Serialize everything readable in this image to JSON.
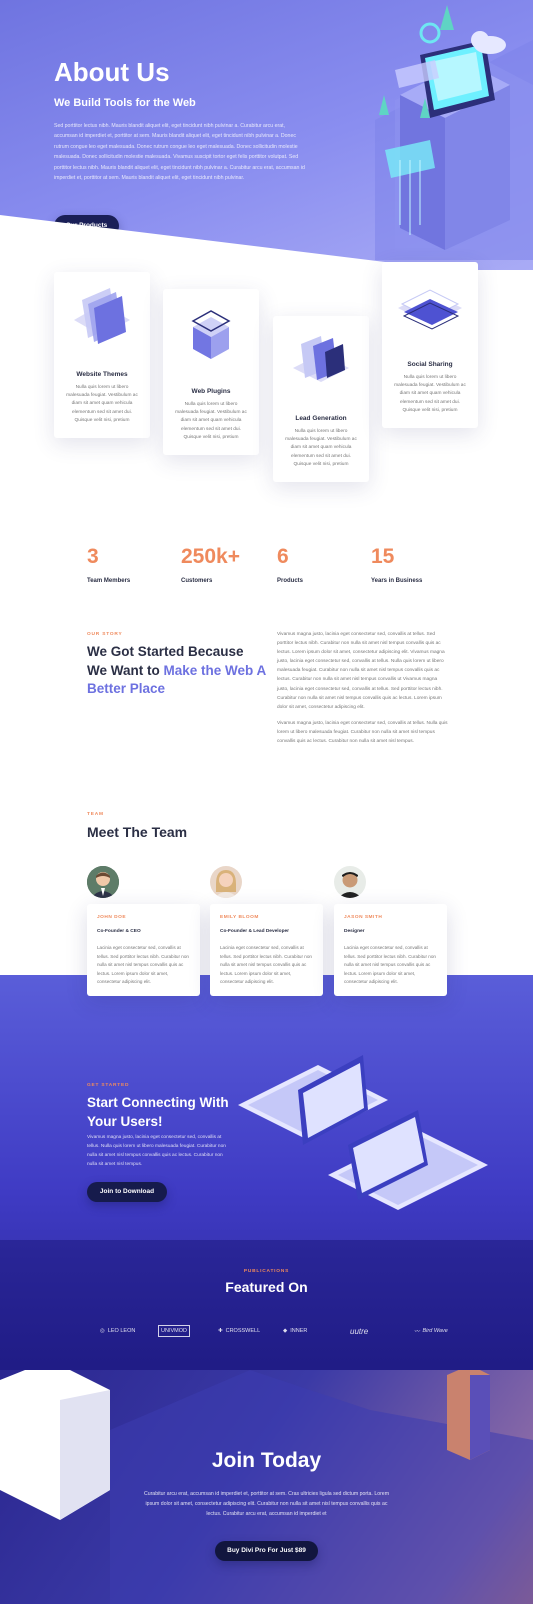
{
  "hero": {
    "title": "About Us",
    "subtitle": "We Build Tools for the Web",
    "text": "Sed porttitor lectus nibh. Mauris blandit aliquet elit, eget tincidunt nibh pulvinar a. Curabitur arcu erat, accumsan id imperdiet et, porttitor at sem. Mauris blandit aliquet elit, eget tincidunt nibh pulvinar a. Donec rutrum congue leo eget malesuada. Donec rutrum congue leo eget malesuada. Donec sollicitudin molestie malesuada. Donec sollicitudin molestie malesuada. Vivamus suscipit tortor eget felis porttitor volutpat. Sed porttitor lectus nibh. Mauris blandit aliquet elit, eget tincidunt nibh pulvinar a. Curabitur arcu erat, accumsan id imperdiet et, porttitor at sem. Mauris blandit aliquet elit, eget tincidunt nibh pulvinar.",
    "button": "Our Products"
  },
  "features": [
    {
      "title": "Website Themes",
      "text": "Nulla quis lorem ut libero malesuada feugiat. Vestibulum ac diam sit amet quam vehicula elementum sed sit amet dui. Quisque velit nisi, pretium",
      "icon": "layers-icon"
    },
    {
      "title": "Web Plugins",
      "text": "Nulla quis lorem ut libero malesuada feugiat. Vestibulum ac diam sit amet quam vehicula elementum sed sit amet dui. Quisque velit nisi, pretium",
      "icon": "cube-icon"
    },
    {
      "title": "Lead Generation",
      "text": "Nulla quis lorem ut libero malesuada feugiat. Vestibulum ac diam sit amet quam vehicula elementum sed sit amet dui. Quisque velit nisi, pretium",
      "icon": "funnel-icon"
    },
    {
      "title": "Social Sharing",
      "text": "Nulla quis lorem ut libero malesuada feugiat. Vestibulum ac diam sit amet quam vehicula elementum sed sit amet dui. Quisque velit nisi, pretium",
      "icon": "tablet-icon"
    }
  ],
  "stats": [
    {
      "value": "3",
      "label": "Team Members"
    },
    {
      "value": "250k+",
      "label": "Customers"
    },
    {
      "value": "6",
      "label": "Products"
    },
    {
      "value": "15",
      "label": "Years in Business"
    }
  ],
  "story": {
    "eyebrow": "OUR STORY",
    "heading_plain": "We Got Started Because We Want to ",
    "heading_accent": "Make the Web A Better Place",
    "para1": "Vivamus magna justo, lacinia eget consectetur sed, convallis at tellus. Sed porttitor lectus nibh. Curabitur non nulla sit amet nisl tempus convallis quis ac lectus. Lorem ipsum dolor sit amet, consectetur adipiscing elit. Vivamus magna justo, lacinia eget consectetur sed, convallis at tellus. Nulla quis lorem ut libero malesuada feugiat. Curabitur non nulla sit amet nisl tempus convallis quis ac lectus. Curabitur non nulla sit amet nisl tempus convallis ut Vivamus magna justo, lacinia eget consectetur sed, convallis at tellus. Sed porttitor lectus nibh. Curabitur non nulla sit amet nisl tempus convallis quis ac lectus. Lorem ipsum dolor sit amet, consectetur adipiscing elit.",
    "para2": "Vivamus magna justo, lacinia eget consectetur sed, convallis at tellus. Nulla quis lorem ut libero malesuada feugiat. Curabitur non nulla sit amet nisl tempus convallis quis ac lectus. Curabitur non nulla sit amet nisl tempus."
  },
  "team": {
    "eyebrow": "TEAM",
    "heading": "Meet The Team",
    "members": [
      {
        "name": "JOHN DOE",
        "role": "Co-Founder & CEO",
        "bio": "Lacinia eget consectetur sed, convallis at tellus. Sed porttitor lectus nibh. Curabitur non nulla sit amet nisl tempus convallis quis ac lectus. Lorem ipsum dolor sit amet, consectetur adipiscing elit."
      },
      {
        "name": "EMILY BLOOM",
        "role": "Co-Founder & Lead Developer",
        "bio": "Lacinia eget consectetur sed, convallis at tellus. Sed porttitor lectus nibh. Curabitur non nulla sit amet nisl tempus convallis quis ac lectus. Lorem ipsum dolor sit amet, consectetur adipiscing elit."
      },
      {
        "name": "JASON SMITH",
        "role": "Designer",
        "bio": "Lacinia eget consectetur sed, convallis at tellus. Sed porttitor lectus nibh. Curabitur non nulla sit amet nisl tempus convallis quis ac lectus. Lorem ipsum dolor sit amet, consectetur adipiscing elit."
      }
    ]
  },
  "cta": {
    "eyebrow": "GET STARTED",
    "heading": "Start Connecting With Your Users!",
    "text": "Vivamus magna justo, lacinia eget consectetur sed, convallis at tellus. Nulla quis lorem ut libero malesuada feugiat. Curabitur non nulla sit amet nisl tempus convallis quis ac lectus. Curabitur non nulla sit amet nisl tempus.",
    "button": "Join to Download"
  },
  "publications": {
    "eyebrow": "PUBLICATIONS",
    "heading": "Featured On",
    "logos": [
      "LEO LEON",
      "UNIVMOD",
      "CROSSWELL",
      "INNER",
      "uutre",
      "Bird Wave"
    ]
  },
  "join": {
    "heading": "Join Today",
    "text": "Curabitur arcu erat, accumsan id imperdiet et, porttitor at sem. Cras ultricies ligula sed dictum porta. Lorem ipsum dolor sit amet, consectetur adipiscing elit. Curabitur non nulla sit amet nisl tempus convallis quis ac lectus. Curabitur arcu erat, accumsan id imperdiet et",
    "button": "Buy Divi Pro For Just $89"
  },
  "colors": {
    "accent": "#ef8a5d",
    "primary": "#6d71e0",
    "dark": "#1a1f57"
  }
}
